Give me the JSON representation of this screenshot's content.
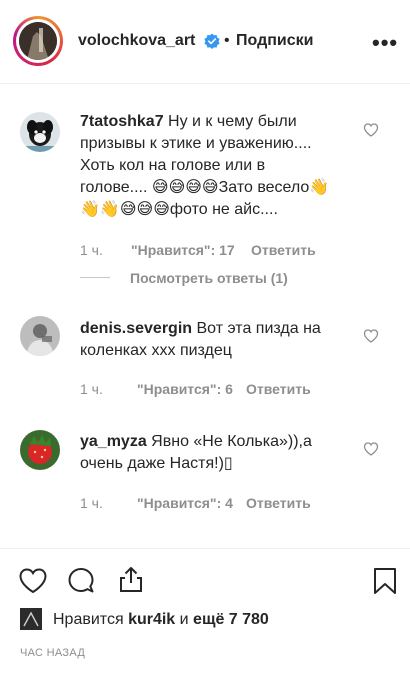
{
  "header": {
    "username": "volochkova_art",
    "dot": "•",
    "follow_label": "Подписки",
    "more_label": "•••"
  },
  "comments": [
    {
      "username": "7tatoshka7",
      "lines": [
        "Ну и к чему были",
        "призывы к этике и уважению....",
        "Хоть кол на голове или в",
        "голове.... 😅😅😅😅Зато весело👋",
        "👋👋😅😅😅фото не айс...."
      ],
      "time": "1 ч.",
      "likes": "\"Нравится\": 17",
      "reply": "Ответить",
      "view_replies": "Посмотреть ответы (1)"
    },
    {
      "username": "denis.severgin",
      "lines": [
        "Вот эта пизда на",
        "коленках ххх пиздец"
      ],
      "time": "1 ч.",
      "likes": "\"Нравится\": 6",
      "reply": "Ответить"
    },
    {
      "username": "ya_myza",
      "lines": [
        "Явно «Не Колька»)),а",
        "очень даже Настя!)▯"
      ],
      "time": "1 ч.",
      "likes": "\"Нравится\": 4",
      "reply": "Ответить"
    }
  ],
  "post": {
    "likes_prefix": "Нравится",
    "likes_user": "kur4ik",
    "likes_and": "и",
    "likes_count": "ещё 7 780",
    "time_ago": "ЧАС НАЗАД"
  }
}
